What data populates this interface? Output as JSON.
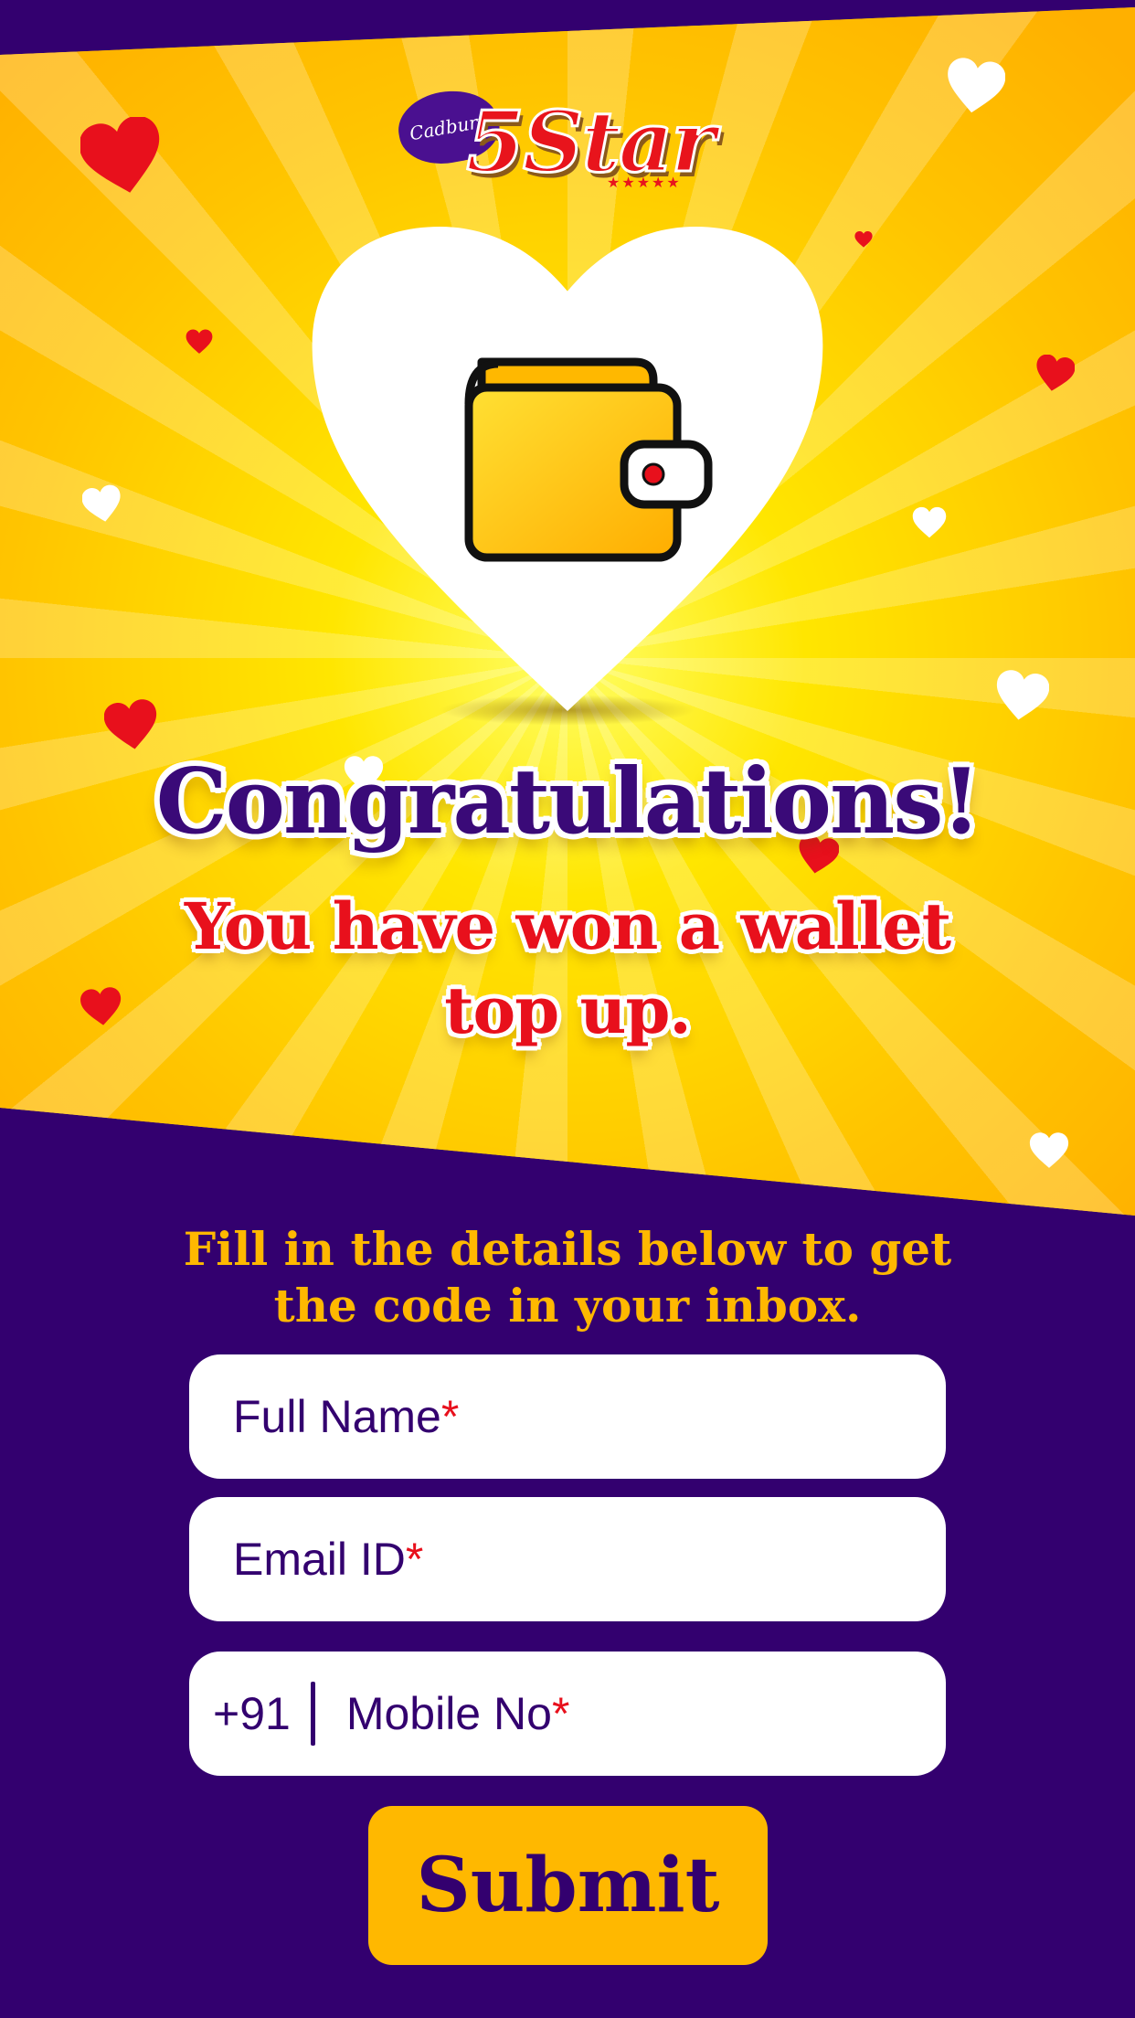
{
  "logo": {
    "brand_small": "Cadbury",
    "brand_main": "5Star",
    "stars": "★★★★★"
  },
  "headline": "Congratulations!",
  "sub_headline": "You have won a wallet top up.",
  "instructions": "Fill in the details below to get the code in your inbox.",
  "form": {
    "full_name": {
      "placeholder": "Full Name",
      "required_mark": "*"
    },
    "email": {
      "placeholder": "Email ID",
      "required_mark": "*"
    },
    "mobile": {
      "country_code": "+91",
      "placeholder": "Mobile No",
      "required_mark": "*"
    }
  },
  "submit_label": "Submit",
  "colors": {
    "purple": "#33006f",
    "yellow": "#ffb800",
    "red": "#e8101c",
    "white": "#ffffff"
  },
  "icons": [
    "wallet-icon",
    "heart-icon"
  ]
}
